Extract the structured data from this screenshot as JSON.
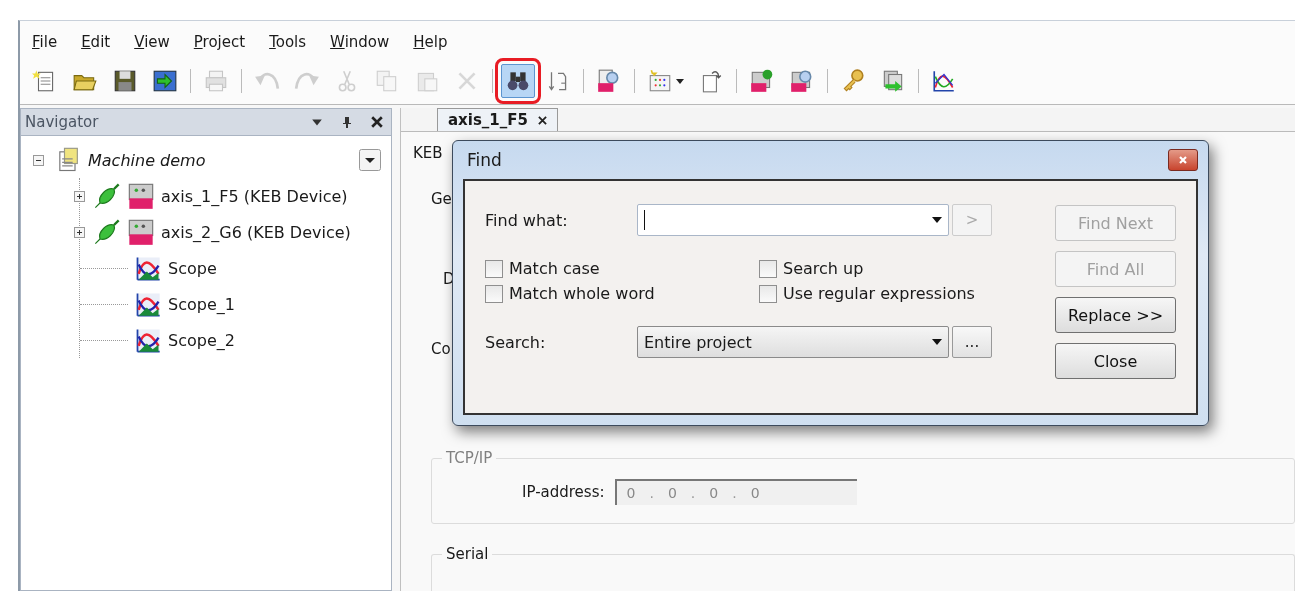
{
  "menu": [
    {
      "label": "File"
    },
    {
      "label": "Edit"
    },
    {
      "label": "View"
    },
    {
      "label": "Project"
    },
    {
      "label": "Tools"
    },
    {
      "label": "Window"
    },
    {
      "label": "Help"
    }
  ],
  "toolbar": [
    {
      "kind": "button",
      "disabled": false
    },
    {
      "kind": "button",
      "disabled": false
    },
    {
      "kind": "button",
      "disabled": false
    },
    {
      "kind": "button",
      "disabled": false
    },
    {
      "kind": "separator"
    },
    {
      "kind": "button",
      "disabled": true
    },
    {
      "kind": "separator"
    },
    {
      "kind": "button",
      "disabled": true
    },
    {
      "kind": "button",
      "disabled": true
    },
    {
      "kind": "button",
      "disabled": true
    },
    {
      "kind": "button",
      "disabled": true
    },
    {
      "kind": "button",
      "disabled": true
    },
    {
      "kind": "button",
      "disabled": true
    },
    {
      "kind": "separator"
    },
    {
      "kind": "button",
      "disabled": false,
      "selected": true,
      "highlighted": true
    },
    {
      "kind": "button",
      "disabled": false
    },
    {
      "kind": "separator"
    },
    {
      "kind": "button",
      "disabled": false
    },
    {
      "kind": "separator"
    },
    {
      "kind": "menu_button",
      "disabled": false
    },
    {
      "kind": "button",
      "disabled": false
    },
    {
      "kind": "separator"
    },
    {
      "kind": "button",
      "disabled": false
    },
    {
      "kind": "button",
      "disabled": false
    },
    {
      "kind": "separator"
    },
    {
      "kind": "button",
      "disabled": false
    },
    {
      "kind": "button",
      "disabled": false
    },
    {
      "kind": "separator"
    },
    {
      "kind": "button",
      "disabled": false
    }
  ],
  "navigator": {
    "title": "Navigator",
    "tree": [
      {
        "label": "Machine demo",
        "kind": "project",
        "expanded": true,
        "children": [
          {
            "label": "axis_1_F5 (KEB Device)",
            "kind": "device",
            "expanded": false
          },
          {
            "label": "axis_2_G6 (KEB Device)",
            "kind": "device",
            "expanded": false
          },
          {
            "label": "Scope",
            "kind": "scope"
          },
          {
            "label": "Scope_1",
            "kind": "scope"
          },
          {
            "label": "Scope_2",
            "kind": "scope"
          }
        ]
      }
    ]
  },
  "document_tab": {
    "label": "axis_1_F5"
  },
  "background_labels": [
    "KEB",
    "Ge",
    "D",
    "Co"
  ],
  "tcp_ip": {
    "legend": "TCP/IP",
    "disabled": true,
    "ip_label": "IP-address:",
    "octets": [
      "0",
      "0",
      "0",
      "0"
    ],
    "separator": "."
  },
  "serial": {
    "legend": "Serial"
  },
  "find_dialog": {
    "title": "Find",
    "find_what_label": "Find what:",
    "next_button": ">",
    "options": [
      {
        "label": "Match case",
        "checked": false
      },
      {
        "label": "Search up",
        "checked": false
      },
      {
        "label": "Match whole word",
        "checked": false
      },
      {
        "label": "Use regular expressions",
        "checked": false
      }
    ],
    "search_label": "Search:",
    "search_value": "Entire project",
    "browse_button": "...",
    "buttons": [
      {
        "label": "Find Next",
        "disabled": true
      },
      {
        "label": "Find All",
        "disabled": true
      },
      {
        "label": "Replace >>",
        "disabled": false
      },
      {
        "label": "Close",
        "disabled": false
      }
    ]
  }
}
